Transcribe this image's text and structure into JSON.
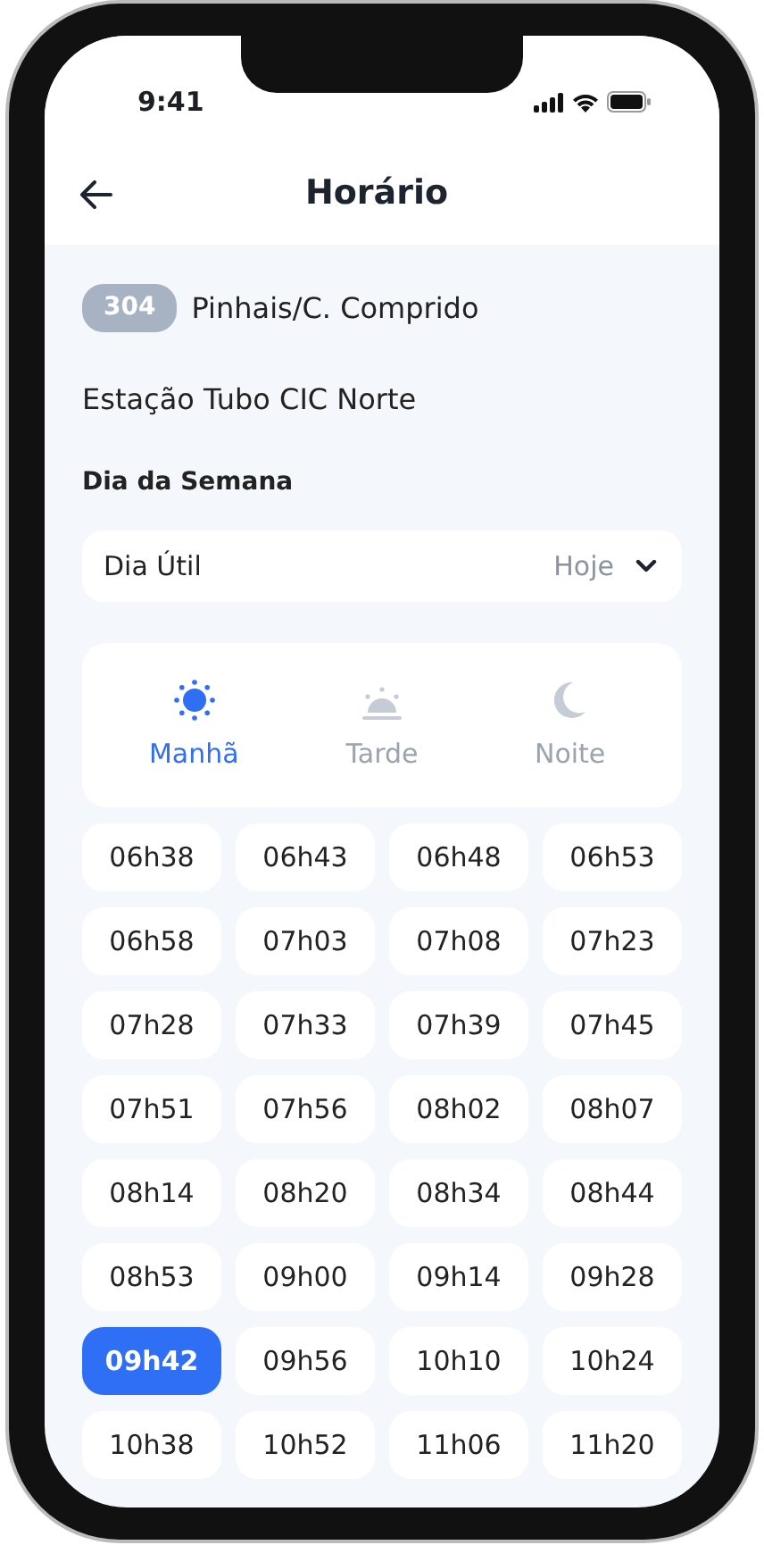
{
  "status_bar": {
    "time": "9:41"
  },
  "header": {
    "title": "Horário"
  },
  "route": {
    "number": "304",
    "name": "Pinhais/C. Comprido"
  },
  "stop": "Estação Tubo CIC Norte",
  "day_section": {
    "label": "Dia da Semana",
    "value": "Dia Útil",
    "hint": "Hoje"
  },
  "periods": [
    {
      "kind": "sun",
      "label": "Manhã",
      "selected": true
    },
    {
      "kind": "sunset",
      "label": "Tarde",
      "selected": false
    },
    {
      "kind": "moon",
      "label": "Noite",
      "selected": false
    }
  ],
  "times": [
    {
      "label": "06h38",
      "selected": false
    },
    {
      "label": "06h43",
      "selected": false
    },
    {
      "label": "06h48",
      "selected": false
    },
    {
      "label": "06h53",
      "selected": false
    },
    {
      "label": "06h58",
      "selected": false
    },
    {
      "label": "07h03",
      "selected": false
    },
    {
      "label": "07h08",
      "selected": false
    },
    {
      "label": "07h23",
      "selected": false
    },
    {
      "label": "07h28",
      "selected": false
    },
    {
      "label": "07h33",
      "selected": false
    },
    {
      "label": "07h39",
      "selected": false
    },
    {
      "label": "07h45",
      "selected": false
    },
    {
      "label": "07h51",
      "selected": false
    },
    {
      "label": "07h56",
      "selected": false
    },
    {
      "label": "08h02",
      "selected": false
    },
    {
      "label": "08h07",
      "selected": false
    },
    {
      "label": "08h14",
      "selected": false
    },
    {
      "label": "08h20",
      "selected": false
    },
    {
      "label": "08h34",
      "selected": false
    },
    {
      "label": "08h44",
      "selected": false
    },
    {
      "label": "08h53",
      "selected": false
    },
    {
      "label": "09h00",
      "selected": false
    },
    {
      "label": "09h14",
      "selected": false
    },
    {
      "label": "09h28",
      "selected": false
    },
    {
      "label": "09h42",
      "selected": true
    },
    {
      "label": "09h56",
      "selected": false
    },
    {
      "label": "10h10",
      "selected": false
    },
    {
      "label": "10h24",
      "selected": false
    },
    {
      "label": "10h38",
      "selected": false
    },
    {
      "label": "10h52",
      "selected": false
    },
    {
      "label": "11h06",
      "selected": false
    },
    {
      "label": "11h20",
      "selected": false
    }
  ]
}
